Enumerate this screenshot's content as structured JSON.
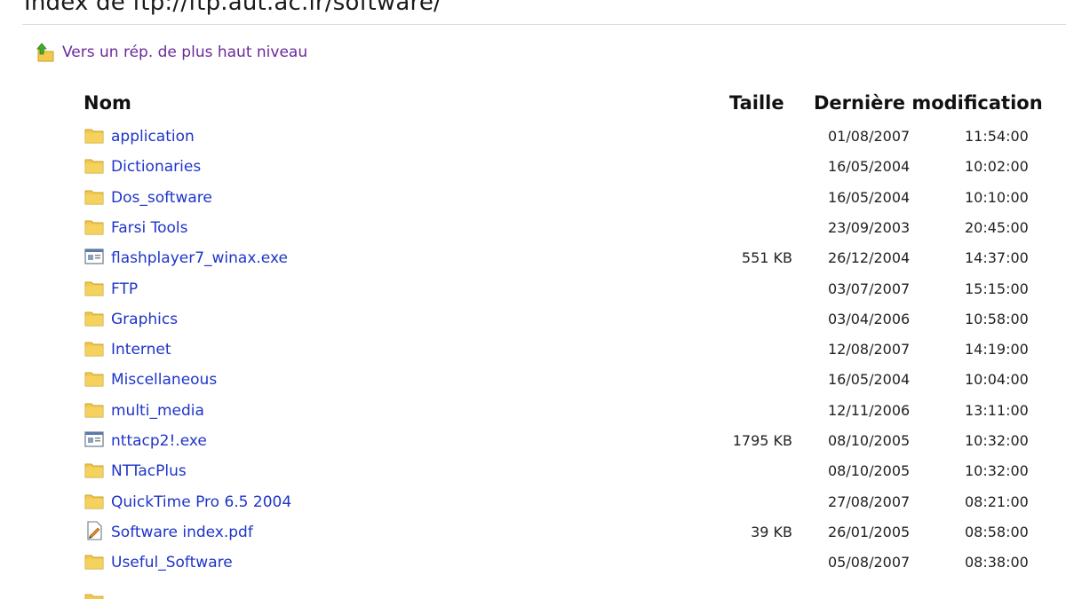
{
  "page": {
    "title": "Index de ftp://ftp.aut.ac.ir/software/",
    "up_link_label": "Vers un rép. de plus haut niveau"
  },
  "columns": {
    "name": "Nom",
    "size": "Taille",
    "modified": "Dernière modification"
  },
  "colors": {
    "link": "#1e35c8",
    "visited_link": "#6a2a9a",
    "folder": "#f2c94c"
  },
  "entries": [
    {
      "icon": "folder-icon",
      "name": "application",
      "size": "",
      "date": "01/08/2007",
      "time": "11:54:00"
    },
    {
      "icon": "folder-icon",
      "name": "Dictionaries",
      "size": "",
      "date": "16/05/2004",
      "time": "10:02:00"
    },
    {
      "icon": "folder-icon",
      "name": "Dos_software",
      "size": "",
      "date": "16/05/2004",
      "time": "10:10:00"
    },
    {
      "icon": "folder-icon",
      "name": "Farsi Tools",
      "size": "",
      "date": "23/09/2003",
      "time": "20:45:00"
    },
    {
      "icon": "executable-icon",
      "name": "flashplayer7_winax.exe",
      "size": "551 KB",
      "date": "26/12/2004",
      "time": "14:37:00"
    },
    {
      "icon": "folder-icon",
      "name": "FTP",
      "size": "",
      "date": "03/07/2007",
      "time": "15:15:00"
    },
    {
      "icon": "folder-icon",
      "name": "Graphics",
      "size": "",
      "date": "03/04/2006",
      "time": "10:58:00"
    },
    {
      "icon": "folder-icon",
      "name": "Internet",
      "size": "",
      "date": "12/08/2007",
      "time": "14:19:00"
    },
    {
      "icon": "folder-icon",
      "name": "Miscellaneous",
      "size": "",
      "date": "16/05/2004",
      "time": "10:04:00"
    },
    {
      "icon": "folder-icon",
      "name": "multi_media",
      "size": "",
      "date": "12/11/2006",
      "time": "13:11:00"
    },
    {
      "icon": "executable-icon",
      "name": "nttacp2!.exe",
      "size": "1795 KB",
      "date": "08/10/2005",
      "time": "10:32:00"
    },
    {
      "icon": "folder-icon",
      "name": "NTTacPlus",
      "size": "",
      "date": "08/10/2005",
      "time": "10:32:00"
    },
    {
      "icon": "folder-icon",
      "name": "QuickTime Pro 6.5 2004",
      "size": "",
      "date": "27/08/2007",
      "time": "08:21:00"
    },
    {
      "icon": "document-icon",
      "name": "Software index.pdf",
      "size": "39 KB",
      "date": "26/01/2005",
      "time": "08:58:00"
    },
    {
      "icon": "folder-icon",
      "name": "Useful_Software",
      "size": "",
      "date": "05/08/2007",
      "time": "08:38:00"
    }
  ]
}
